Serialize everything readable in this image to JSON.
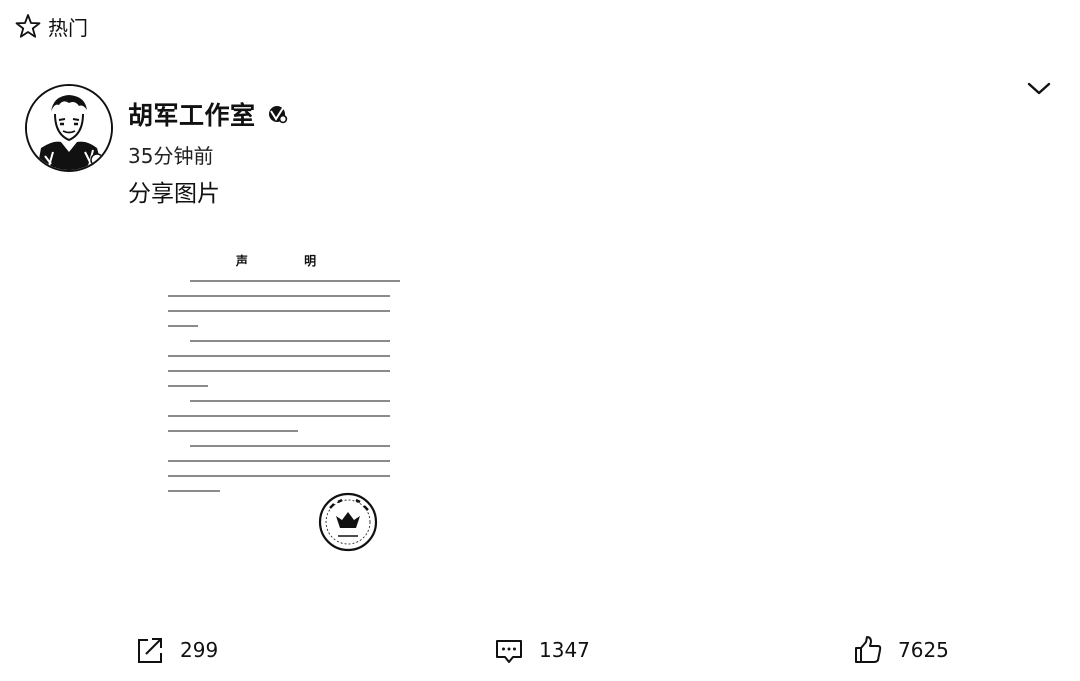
{
  "header": {
    "section_label": "热门",
    "icons": {
      "favorite": "star-outline-icon",
      "collapse": "chevron-down-icon"
    }
  },
  "post": {
    "author": {
      "name": "胡军工作室",
      "badge": "verified-v-icon",
      "avatar": "avatar-sketch-portrait"
    },
    "time": "35分钟前",
    "text": "分享图片",
    "image": {
      "title": "声 明",
      "seal": "red-company-seal"
    }
  },
  "actions": {
    "share": {
      "icon": "share-icon",
      "count": "299"
    },
    "comment": {
      "icon": "comment-icon",
      "count": "1347"
    },
    "like": {
      "icon": "thumbs-up-icon",
      "count": "7625"
    }
  }
}
